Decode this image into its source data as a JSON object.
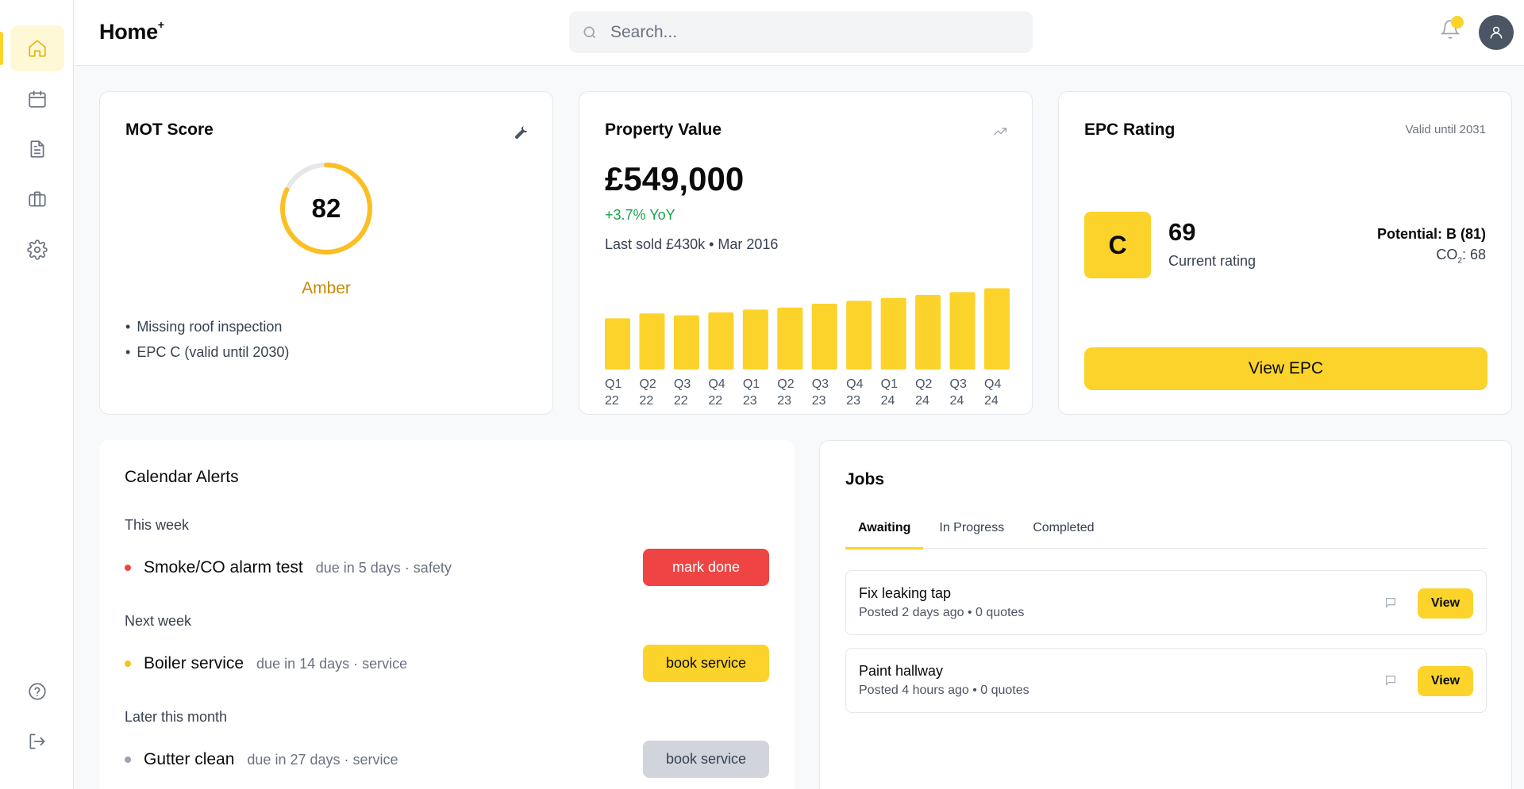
{
  "brand": {
    "name": "Home",
    "mark": "+"
  },
  "search": {
    "placeholder": "Search..."
  },
  "mot": {
    "title": "MOT Score",
    "score": "82",
    "score_fraction": 0.82,
    "status": "Amber",
    "issues": [
      "Missing roof inspection",
      "EPC C (valid until 2030)"
    ]
  },
  "property": {
    "title": "Property Value",
    "value": "£549,000",
    "yoy": "+3.7% YoY",
    "last_sold": "Last sold £430k • Mar 2016"
  },
  "chart_data": {
    "type": "bar",
    "categories": [
      [
        "Q1",
        "22"
      ],
      [
        "Q2",
        "22"
      ],
      [
        "Q3",
        "22"
      ],
      [
        "Q4",
        "22"
      ],
      [
        "Q1",
        "23"
      ],
      [
        "Q2",
        "23"
      ],
      [
        "Q3",
        "23"
      ],
      [
        "Q4",
        "23"
      ],
      [
        "Q1",
        "24"
      ],
      [
        "Q2",
        "24"
      ],
      [
        "Q3",
        "24"
      ],
      [
        "Q4",
        "24"
      ]
    ],
    "values": [
      53,
      58,
      56,
      59,
      62,
      64,
      68,
      71,
      74,
      77,
      80,
      84
    ],
    "ylim": [
      0,
      100
    ],
    "color": "#fcd32a",
    "title": "",
    "xlabel": "",
    "ylabel": ""
  },
  "epc": {
    "title": "EPC Rating",
    "valid": "Valid until 2031",
    "band": "C",
    "score": "69",
    "current_label": "Current rating",
    "potential": "Potential: B (81)",
    "co2_label": "CO",
    "co2_sub": "2",
    "co2_value": ": 68",
    "button": "View EPC"
  },
  "calendar": {
    "title": "Calendar Alerts",
    "sections": [
      {
        "label": "This week",
        "item": {
          "name": "Smoke/CO alarm test",
          "meta": "due in 5 days · safety",
          "button": "mark done",
          "dot": "#ef4444",
          "btn_bg": "#ef4444",
          "btn_fg": "#ffffff"
        }
      },
      {
        "label": "Next week",
        "item": {
          "name": "Boiler service",
          "meta": "due in 14 days · service",
          "button": "book service",
          "dot": "#f5c518",
          "btn_bg": "#fcd32a",
          "btn_fg": "#0b0b0b"
        }
      },
      {
        "label": "Later this month",
        "item": {
          "name": "Gutter clean",
          "meta": "due in 27 days · service",
          "button": "book service",
          "dot": "#9ca3af",
          "btn_bg": "#d1d5db",
          "btn_fg": "#374151"
        }
      }
    ]
  },
  "jobs": {
    "title": "Jobs",
    "tabs": [
      "Awaiting",
      "In Progress",
      "Completed"
    ],
    "items": [
      {
        "title": "Fix leaking tap",
        "meta": "Posted 2 days ago • 0 quotes",
        "button": "View"
      },
      {
        "title": "Paint hallway",
        "meta": "Posted 4 hours ago • 0 quotes",
        "button": "View"
      }
    ]
  }
}
